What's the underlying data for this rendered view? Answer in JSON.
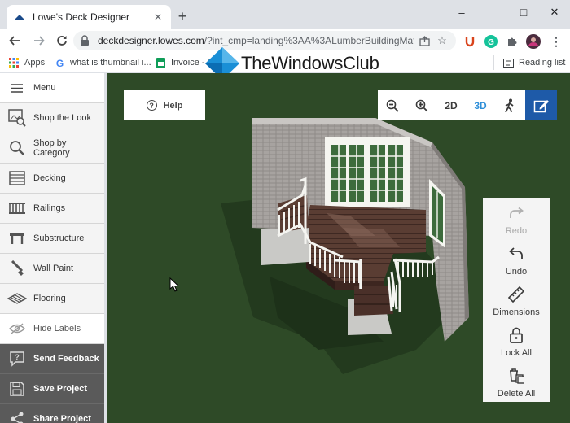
{
  "browser": {
    "tab_title": "Lowe's Deck Designer",
    "new_tab": "+",
    "url_host": "deckdesigner.lowes.com",
    "url_rest": "/?int_cmp=landing%3AA%3ALumberBuildingMat...",
    "controls": {
      "minimize": "–",
      "maximize": "□",
      "close": "✕"
    }
  },
  "bookmarks": [
    {
      "label": "Apps",
      "icon": "apps-grid-icon"
    },
    {
      "label": "what is thumbnail i...",
      "icon": "google-icon"
    },
    {
      "label": "Invoice - G",
      "icon": "sheets-icon"
    }
  ],
  "reading_list": "Reading list",
  "watermark": "TheWindowsClub",
  "sidebar": [
    {
      "label": "Menu",
      "icon": "hamburger-icon"
    },
    {
      "label": "Shop the Look",
      "icon": "shop-look-icon"
    },
    {
      "label": "Shop by Category",
      "icon": "magnifier-icon"
    },
    {
      "label": "Decking",
      "icon": "decking-icon"
    },
    {
      "label": "Railings",
      "icon": "railings-icon"
    },
    {
      "label": "Substructure",
      "icon": "substructure-icon"
    },
    {
      "label": "Wall Paint",
      "icon": "paint-brush-icon"
    },
    {
      "label": "Flooring",
      "icon": "flooring-icon"
    },
    {
      "label": "Hide Labels",
      "icon": "eye-slash-icon"
    },
    {
      "label": "Send Feedback",
      "icon": "feedback-icon"
    },
    {
      "label": "Save Project",
      "icon": "floppy-icon"
    },
    {
      "label": "Share Project",
      "icon": "share-icon"
    }
  ],
  "viewport": {
    "help": "Help",
    "view_2d": "2D",
    "view_3d": "3D",
    "active_view": "3D",
    "actions": [
      {
        "label": "Redo",
        "icon": "redo-icon",
        "enabled": false
      },
      {
        "label": "Undo",
        "icon": "undo-icon",
        "enabled": true
      },
      {
        "label": "Dimensions",
        "icon": "ruler-icon",
        "enabled": true
      },
      {
        "label": "Lock All",
        "icon": "lock-icon",
        "enabled": true
      },
      {
        "label": "Delete All",
        "icon": "delete-all-icon",
        "enabled": true
      }
    ]
  },
  "colors": {
    "grass": "#2e4a27",
    "accent_blue": "#1e5aa8",
    "active_view": "#2f8fd8",
    "sidebar_dark": "#5a5a5a"
  }
}
